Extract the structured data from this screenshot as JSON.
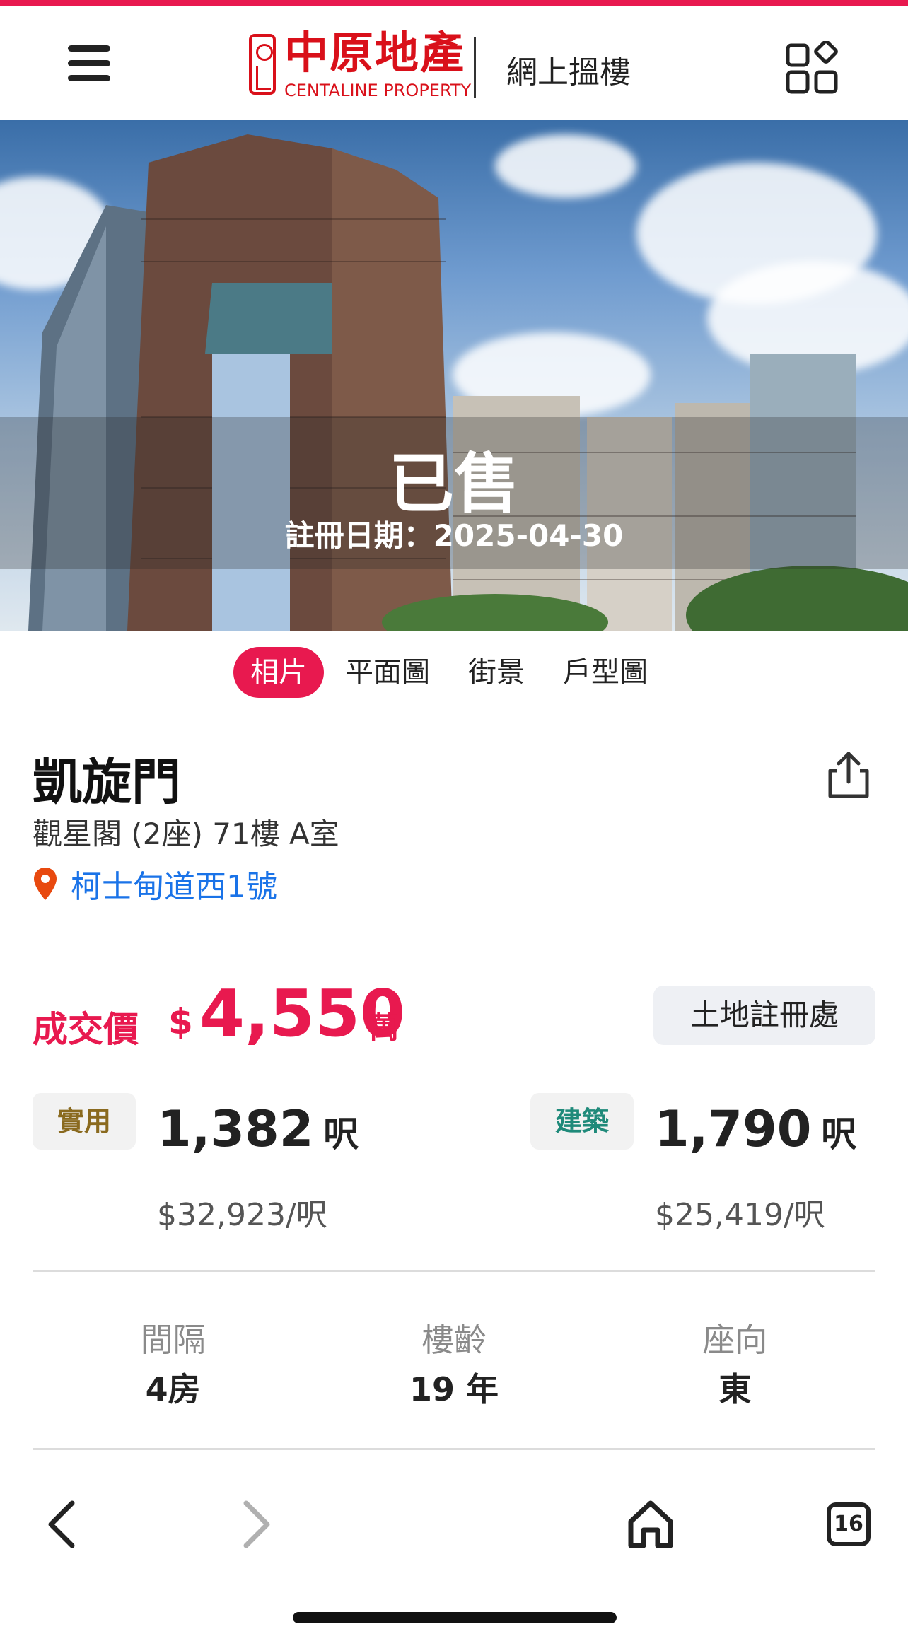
{
  "header": {
    "brand_cn": "中原地產",
    "brand_en": "CENTALINE PROPERTY",
    "service": "網上搵樓",
    "accent_color": "#e8194f"
  },
  "hero": {
    "status": "已售",
    "registration": "註冊日期：2025-04-30"
  },
  "media_tabs": [
    {
      "label": "相片",
      "active": true
    },
    {
      "label": "平面圖",
      "active": false
    },
    {
      "label": "街景",
      "active": false
    },
    {
      "label": "戶型圖",
      "active": false
    }
  ],
  "property": {
    "estate": "凱旋門",
    "unit": "觀星閣 (2座) 71樓 A室",
    "street": "柯士甸道西1號"
  },
  "price": {
    "label": "成交價",
    "currency": "$",
    "value": "4,550",
    "unit": "萬",
    "land_registry_button": "土地註冊處"
  },
  "areas": {
    "saleable": {
      "badge": "實用",
      "value": "1,382",
      "unit": "呎",
      "price_per_ft": "$32,923/呎",
      "badge_color": "#8a6a1f"
    },
    "gross": {
      "badge": "建築",
      "value": "1,790",
      "unit": "呎",
      "price_per_ft": "$25,419/呎",
      "badge_color": "#1f8a7a"
    }
  },
  "facts": [
    {
      "label": "間隔",
      "value": "4房"
    },
    {
      "label": "樓齡",
      "value": "19 年"
    },
    {
      "label": "座向",
      "value": "東"
    }
  ],
  "browser": {
    "tab_count": "16"
  },
  "icons": {
    "menu": "hamburger-menu-icon",
    "apps": "apps-grid-icon",
    "share": "share-icon",
    "location": "location-pin-icon",
    "back": "back-arrow-icon",
    "forward": "forward-arrow-icon",
    "home": "home-icon",
    "tabs": "tabs-icon"
  }
}
